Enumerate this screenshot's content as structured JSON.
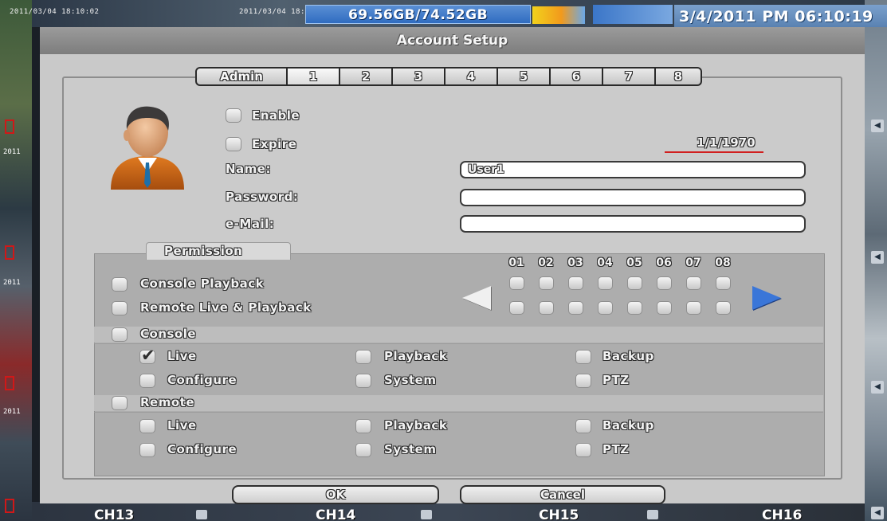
{
  "osd": {
    "left_timestamp": "2011/03/04 18:10:02",
    "mid_timestamp": "2011/03/04 18:",
    "disk_usage": "69.56GB/74.52GB",
    "clock": "3/4/2011 PM 06:10:19",
    "left_tile_text": "2011",
    "channels": [
      "CH13",
      "CH14",
      "CH15",
      "CH16"
    ]
  },
  "dialog": {
    "title": "Account Setup"
  },
  "tabs": [
    {
      "label": "Admin",
      "active": false
    },
    {
      "label": "1",
      "active": true
    },
    {
      "label": "2",
      "active": false
    },
    {
      "label": "3",
      "active": false
    },
    {
      "label": "4",
      "active": false
    },
    {
      "label": "5",
      "active": false
    },
    {
      "label": "6",
      "active": false
    },
    {
      "label": "7",
      "active": false
    },
    {
      "label": "8",
      "active": false
    }
  ],
  "account": {
    "enable_label": "Enable",
    "enable_checked": false,
    "expire_label": "Expire",
    "expire_checked": false,
    "expire_date": "1/1/1970",
    "name_label": "Name:",
    "name_value": "User1",
    "password_label": "Password:",
    "password_value": "",
    "email_label": "e-Mail:",
    "email_value": ""
  },
  "permission": {
    "tab_label": "Permission",
    "console_playback_label": "Console Playback",
    "remote_live_playback_label": "Remote Live & Playback",
    "channels": [
      "01",
      "02",
      "03",
      "04",
      "05",
      "06",
      "07",
      "08"
    ],
    "console_section_label": "Console",
    "remote_section_label": "Remote",
    "console": {
      "live": "Live",
      "live_checked": true,
      "playback": "Playback",
      "backup": "Backup",
      "configure": "Configure",
      "system": "System",
      "ptz": "PTZ"
    },
    "remote": {
      "live": "Live",
      "playback": "Playback",
      "backup": "Backup",
      "configure": "Configure",
      "system": "System",
      "ptz": "PTZ"
    }
  },
  "buttons": {
    "ok": "OK",
    "cancel": "Cancel"
  },
  "colors": {
    "dialog_bg": "#c9c9c9",
    "title_bar": "#8a8a8a",
    "accent_arrow": "#3a76d8",
    "date_underline": "#d11f1f"
  }
}
